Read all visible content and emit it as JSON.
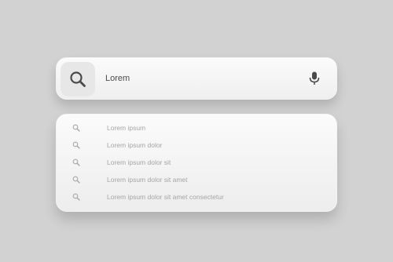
{
  "search": {
    "value": "Lorem",
    "search_icon": "search-icon",
    "mic_icon": "microphone-icon"
  },
  "suggestions": {
    "icon": "search-icon",
    "items": [
      {
        "label": "Lorem ipsum"
      },
      {
        "label": "Lorem ipsum dolor"
      },
      {
        "label": "Lorem ipsum dolor sit"
      },
      {
        "label": "Lorem ipsum dolor sit amet"
      },
      {
        "label": "Lorem ipsum dolor sit amet consectetur"
      }
    ]
  },
  "colors": {
    "background": "#d2d2d2",
    "icon": "#4a4a4a",
    "suggestion_text": "#a5a5a5"
  }
}
